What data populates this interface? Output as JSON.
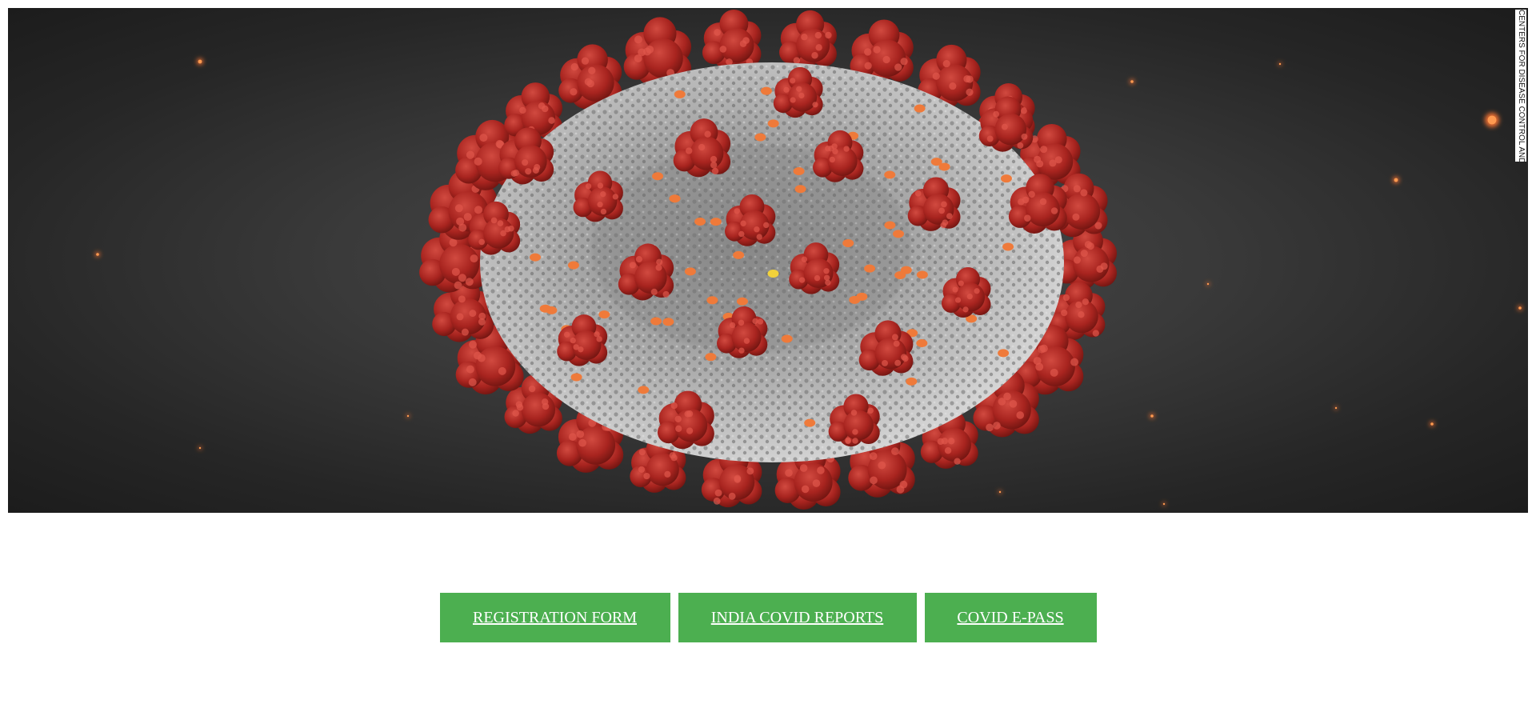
{
  "hero": {
    "image_label": "coronavirus illustration",
    "credit_text": "CENTERS FOR DISEASE CONTROL AND PREVENTION"
  },
  "buttons": [
    {
      "label": "REGISTRATION FORM"
    },
    {
      "label": "INDIA COVID REPORTS"
    },
    {
      "label": "COVID E-PASS"
    }
  ],
  "colors": {
    "button_bg": "#4CAF50",
    "button_text": "#ffffff",
    "hero_bg": "#2e2e2e",
    "spike": "#b32a24",
    "core": "#a9a9a9"
  }
}
